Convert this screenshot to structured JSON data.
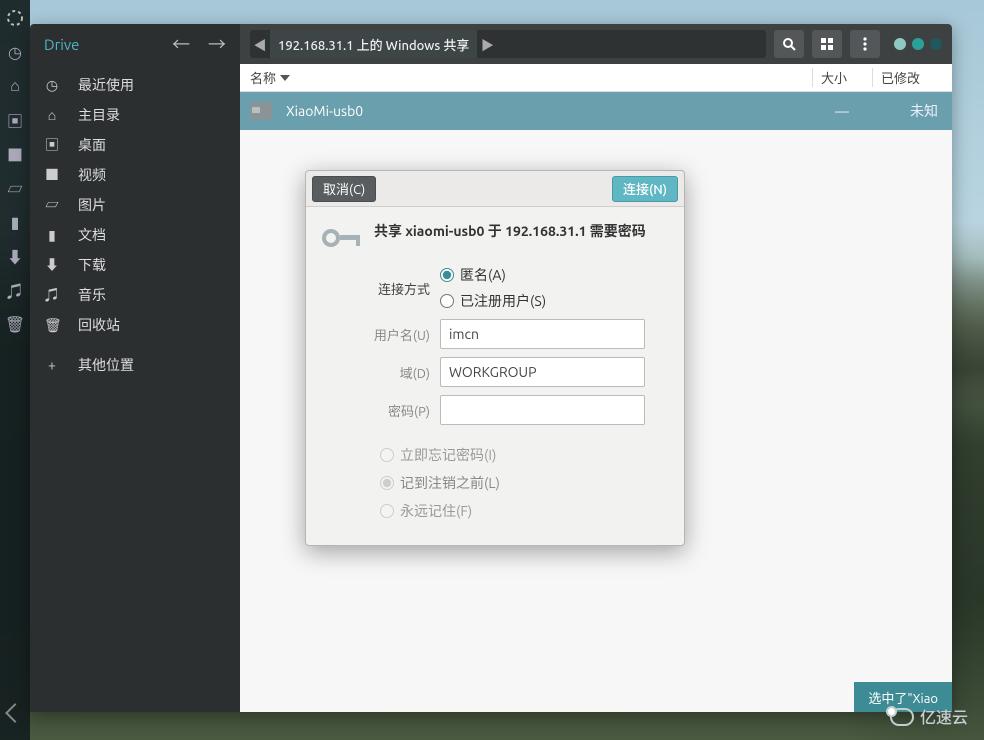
{
  "launcher": {
    "icons": [
      "ubuntu",
      "files",
      "terminal",
      "browser",
      "settings"
    ]
  },
  "window": {
    "app": "Drive",
    "path_location": "192.168.31.1 上的 Windows 共享",
    "window_dots": [
      "#8fc9c4",
      "#2aa19a",
      "#1f595d"
    ]
  },
  "sidebar": {
    "items": [
      {
        "icon": "◷",
        "label": "最近使用"
      },
      {
        "icon": "⌂",
        "label": "主目录"
      },
      {
        "icon": "▣",
        "label": "桌面"
      },
      {
        "icon": "■",
        "label": "视频"
      },
      {
        "icon": "▱",
        "label": "图片"
      },
      {
        "icon": "▮",
        "label": "文档"
      },
      {
        "icon": "⬇",
        "label": "下载"
      },
      {
        "icon": "♫",
        "label": "音乐"
      },
      {
        "icon": "🗑",
        "label": "回收站"
      }
    ],
    "other": {
      "icon": "+",
      "label": "其他位置"
    }
  },
  "columns": {
    "name": "名称",
    "size": "大小",
    "modified": "已修改"
  },
  "row": {
    "name": "XiaoMi-usb0",
    "size": "—",
    "modified": "未知"
  },
  "status": "选中了\"Xiao",
  "dialog": {
    "cancel": "取消(C)",
    "connect": "连接(N)",
    "title": "共享 xiaomi-usb0 于 192.168.31.1 需要密码",
    "method_label": "连接方式",
    "anon": "匿名(A)",
    "registered": "已注册用户(S)",
    "user_label": "用户名(U)",
    "user_value": "imcn",
    "domain_label": "域(D)",
    "domain_value": "WORKGROUP",
    "pass_label": "密码(P)",
    "pass_value": "",
    "forget_now": "立即忘记密码(I)",
    "until_logout": "记到注销之前(L)",
    "remember_forever": "永远记住(F)"
  },
  "watermark": "亿速云"
}
